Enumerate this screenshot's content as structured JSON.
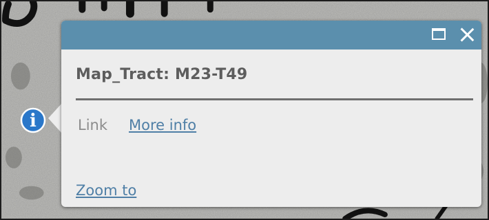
{
  "popup": {
    "title": "Map_Tract: M23-T49",
    "fields": [
      {
        "label": "Link",
        "value": "More info"
      }
    ],
    "actions": {
      "zoom_to": "Zoom to"
    },
    "header_buttons": [
      "maximize-icon",
      "close-icon"
    ]
  },
  "map": {
    "marker_icon": "info-icon",
    "marker_glyph": "i"
  },
  "colors": {
    "header": "#5b8fad",
    "popup_background": "#ededed",
    "link": "#4f7fa6",
    "marker": "#2a77c9"
  }
}
